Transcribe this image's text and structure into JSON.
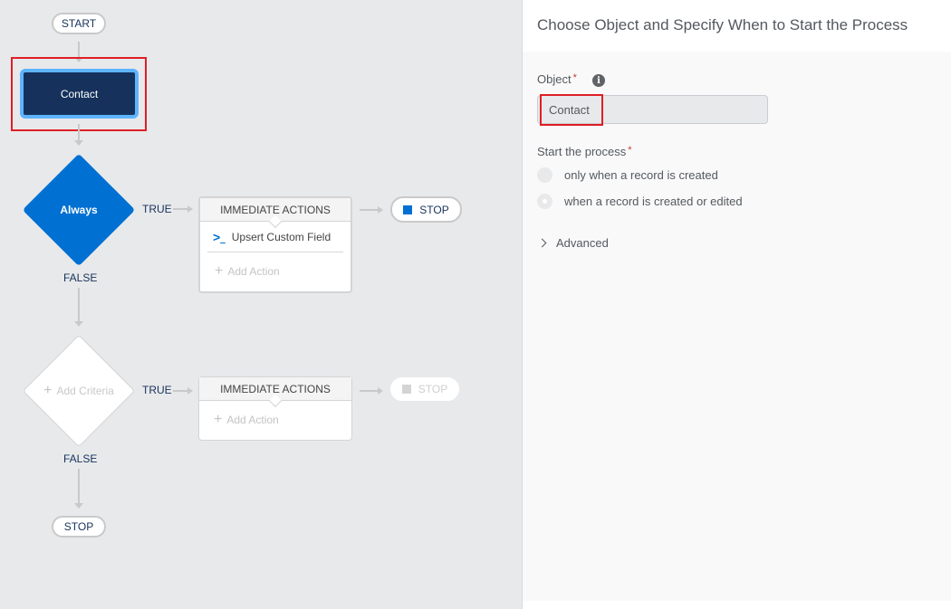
{
  "canvas": {
    "start_label": "START",
    "object_node": {
      "label": "Contact"
    },
    "criteria_1": {
      "label": "Always",
      "true_label": "TRUE",
      "false_label": "FALSE",
      "actions": {
        "header": "IMMEDIATE ACTIONS",
        "items": [
          {
            "icon": "apex-icon",
            "label": "Upsert Custom Field"
          }
        ],
        "add_action_label": "Add Action"
      },
      "stop_label": "STOP"
    },
    "criteria_2": {
      "label": "Add Criteria",
      "true_label": "TRUE",
      "false_label": "FALSE",
      "actions": {
        "header": "IMMEDIATE ACTIONS",
        "add_action_label": "Add Action"
      },
      "stop_label": "STOP"
    },
    "end_label": "STOP"
  },
  "panel": {
    "title": "Choose Object and Specify When to Start the Process",
    "object_label": "Object",
    "required_mark": "*",
    "info_icon": "i",
    "object_value": "Contact",
    "start_label": "Start the process",
    "options": [
      {
        "label": "only when a record is created",
        "checked": false
      },
      {
        "label": "when a record is created or edited",
        "checked": true
      }
    ],
    "advanced_label": "Advanced"
  },
  "colors": {
    "node_dark": "#16325c",
    "node_border": "#5eb4ff",
    "criteria_blue": "#0070d2",
    "highlight_red": "#e01e26",
    "canvas_bg": "#e8e9eb"
  }
}
